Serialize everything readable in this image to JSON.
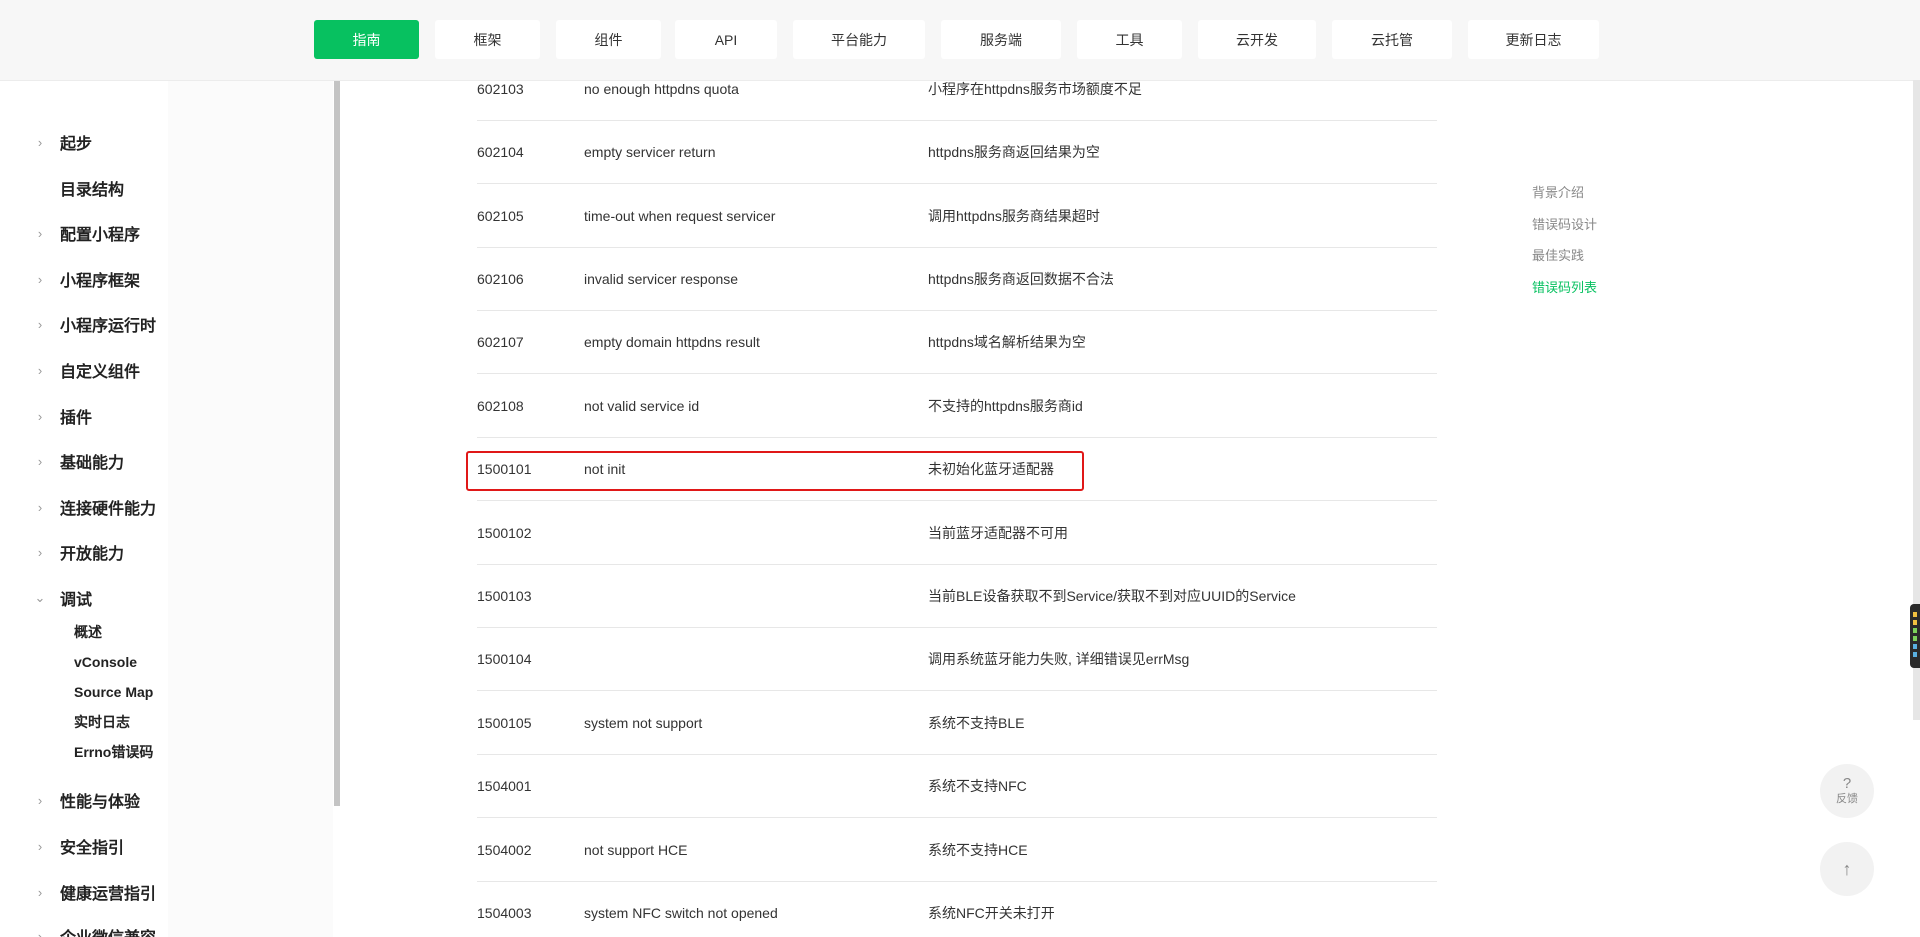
{
  "nav": {
    "tabs": [
      {
        "label": "指南",
        "active": true
      },
      {
        "label": "框架"
      },
      {
        "label": "组件"
      },
      {
        "label": "API"
      },
      {
        "label": "平台能力"
      },
      {
        "label": "服务端"
      },
      {
        "label": "工具"
      },
      {
        "label": "云开发"
      },
      {
        "label": "云托管"
      },
      {
        "label": "更新日志"
      }
    ]
  },
  "sidebar": {
    "items": [
      {
        "label": "起步",
        "chevron": "›"
      },
      {
        "label": "目录结构",
        "chevron": ""
      },
      {
        "label": "配置小程序",
        "chevron": "›"
      },
      {
        "label": "小程序框架",
        "chevron": "›"
      },
      {
        "label": "小程序运行时",
        "chevron": "›"
      },
      {
        "label": "自定义组件",
        "chevron": "›"
      },
      {
        "label": "插件",
        "chevron": "›"
      },
      {
        "label": "基础能力",
        "chevron": "›"
      },
      {
        "label": "连接硬件能力",
        "chevron": "›"
      },
      {
        "label": "开放能力",
        "chevron": "›"
      },
      {
        "label": "调试",
        "chevron": "⌄"
      }
    ],
    "sub_items": [
      {
        "label": "概述"
      },
      {
        "label": "vConsole"
      },
      {
        "label": "Source Map"
      },
      {
        "label": "实时日志"
      },
      {
        "label": "Errno错误码"
      }
    ],
    "after_items": [
      {
        "label": "性能与体验",
        "chevron": "›"
      },
      {
        "label": "安全指引",
        "chevron": "›"
      },
      {
        "label": "健康运营指引",
        "chevron": "›"
      },
      {
        "label": "企业微信兼容",
        "chevron": "›"
      }
    ]
  },
  "table": {
    "rows": [
      {
        "code": "602103",
        "msg": "no enough httpdns quota",
        "desc": "小程序在httpdns服务市场额度不足"
      },
      {
        "code": "602104",
        "msg": "empty servicer return",
        "desc": "httpdns服务商返回结果为空"
      },
      {
        "code": "602105",
        "msg": "time-out when request servicer",
        "desc": "调用httpdns服务商结果超时"
      },
      {
        "code": "602106",
        "msg": "invalid servicer response",
        "desc": "httpdns服务商返回数据不合法"
      },
      {
        "code": "602107",
        "msg": "empty domain httpdns result",
        "desc": "httpdns域名解析结果为空"
      },
      {
        "code": "602108",
        "msg": "not valid service id",
        "desc": "不支持的httpdns服务商id"
      },
      {
        "code": "1500101",
        "msg": "not init",
        "desc": "未初始化蓝牙适配器"
      },
      {
        "code": "1500102",
        "msg": "",
        "desc": "当前蓝牙适配器不可用"
      },
      {
        "code": "1500103",
        "msg": "",
        "desc": "当前BLE设备获取不到Service/获取不到对应UUID的Service"
      },
      {
        "code": "1500104",
        "msg": "",
        "desc": "调用系统蓝牙能力失败, 详细错误见errMsg"
      },
      {
        "code": "1500105",
        "msg": "system not support",
        "desc": "系统不支持BLE"
      },
      {
        "code": "1504001",
        "msg": "",
        "desc": "系统不支持NFC"
      },
      {
        "code": "1504002",
        "msg": "not support HCE",
        "desc": "系统不支持HCE"
      },
      {
        "code": "1504003",
        "msg": "system NFC switch not opened",
        "desc": "系统NFC开关未打开"
      }
    ]
  },
  "toc": {
    "items": [
      {
        "label": "背景介绍"
      },
      {
        "label": "错误码设计"
      },
      {
        "label": "最佳实践"
      },
      {
        "label": "错误码列表",
        "active": true
      }
    ]
  },
  "fab": {
    "feedback_icon": "?",
    "feedback_label": "反馈",
    "top_icon": "↑"
  },
  "colors": {
    "accent": "#07c160",
    "highlight": "#e01818"
  }
}
